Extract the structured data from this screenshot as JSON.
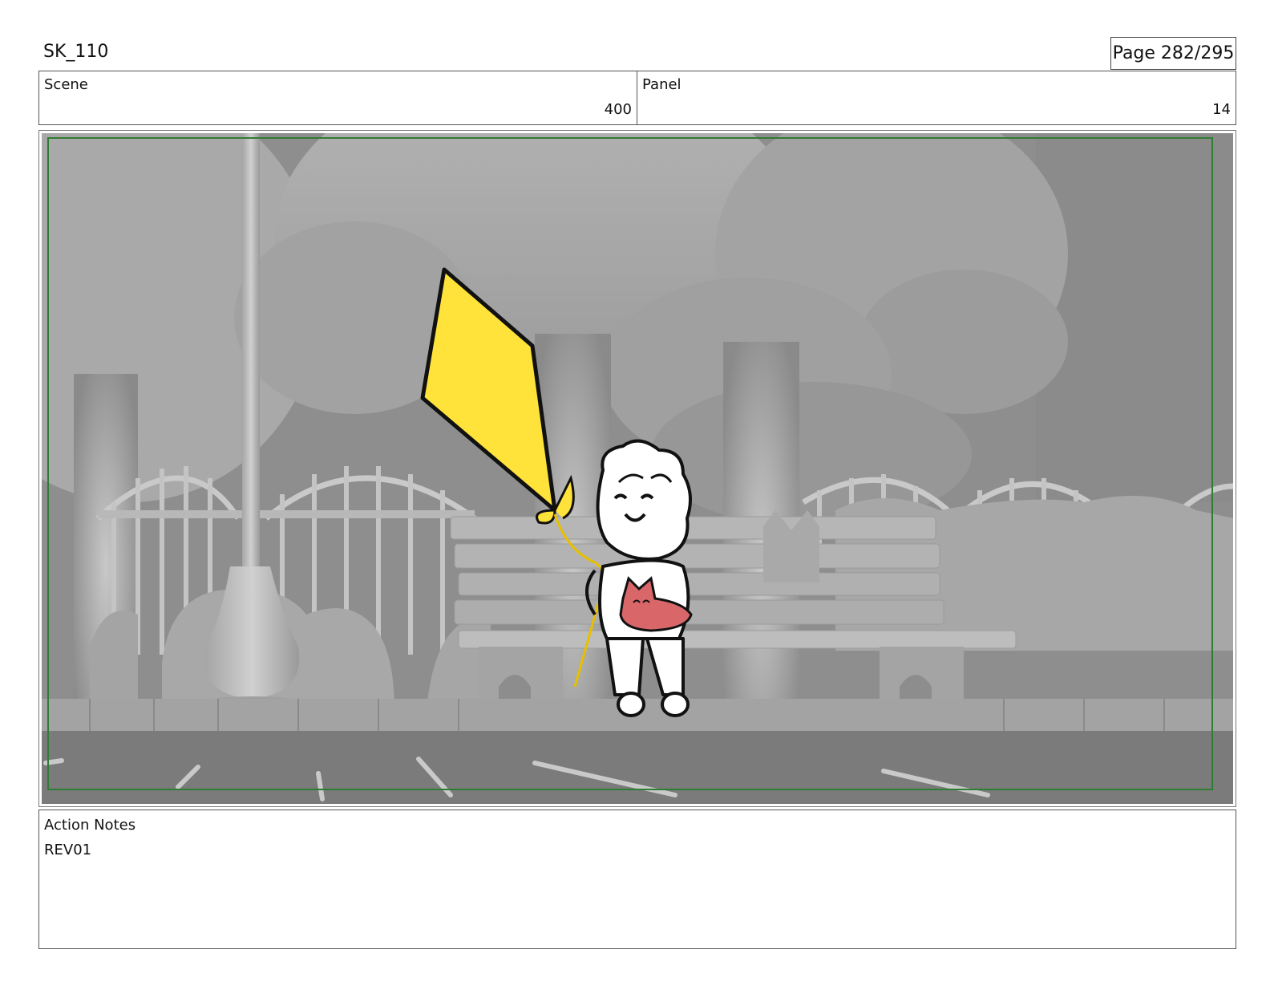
{
  "header": {
    "title": "SK_110",
    "page": "Page 282/295"
  },
  "info": {
    "scene_label": "Scene",
    "scene_value": "400",
    "panel_label": "Panel",
    "panel_value": "14"
  },
  "notes": {
    "label": "Action Notes",
    "text": "REV01"
  },
  "colors": {
    "kite": "#ffe33a",
    "cat": "#d9676a",
    "safe_frame": "#2f7d32",
    "background": "#8f8f8f"
  },
  "icons": [
    "kite-icon"
  ]
}
